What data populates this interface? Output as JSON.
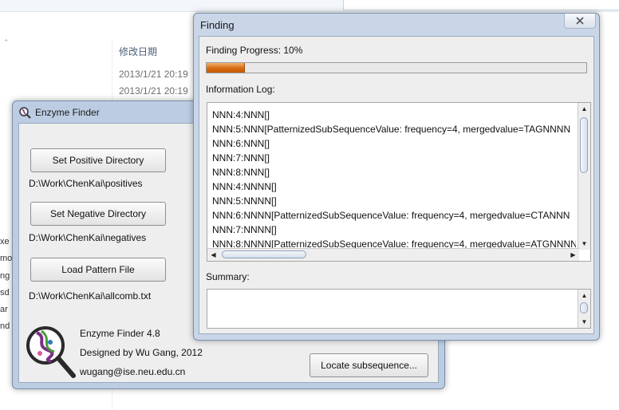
{
  "background": {
    "column_header": "修改日期",
    "dates": [
      "2013/1/21 20:19",
      "2013/1/21 20:19"
    ],
    "fragments": [
      "xe",
      "mo",
      "ng",
      "sd",
      "ar",
      "nd"
    ]
  },
  "enzyme_finder": {
    "title": "Enzyme Finder",
    "set_positive_label": "Set Positive Directory",
    "positive_path": "D:\\Work\\ChenKai\\positives",
    "set_negative_label": "Set Negative Directory",
    "negative_path": "D:\\Work\\ChenKai\\negatives",
    "load_pattern_label": "Load Pattern File",
    "pattern_path": "D:\\Work\\ChenKai\\allcomb.txt",
    "about_name": "Enzyme Finder 4.8",
    "about_author": "Designed by Wu Gang, 2012",
    "about_email": "wugang@ise.neu.edu.cn",
    "locate_label": "Locate subsequence..."
  },
  "finding": {
    "title": "Finding",
    "progress_label": "Finding Progress: 10%",
    "progress_fraction": 0.1,
    "progress_color": "#d86a12",
    "info_log_label": "Information Log:",
    "log_lines": [
      "NNN:4:NNN[]",
      "NNN:5:NNN[PatternizedSubSequenceValue: frequency=4, mergedvalue=TAGNNNN",
      "NNN:6:NNN[]",
      "NNN:7:NNN[]",
      "NNN:8:NNN[]",
      "NNN:4:NNNN[]",
      "NNN:5:NNNN[]",
      "NNN:6:NNNN[PatternizedSubSequenceValue: frequency=4, mergedvalue=CTANNN",
      "NNN:7:NNNN[]",
      "NNN:8:NNNN[PatternizedSubSequenceValue: frequency=4, mergedvalue=ATGNNNN"
    ],
    "summary_label": "Summary:"
  }
}
